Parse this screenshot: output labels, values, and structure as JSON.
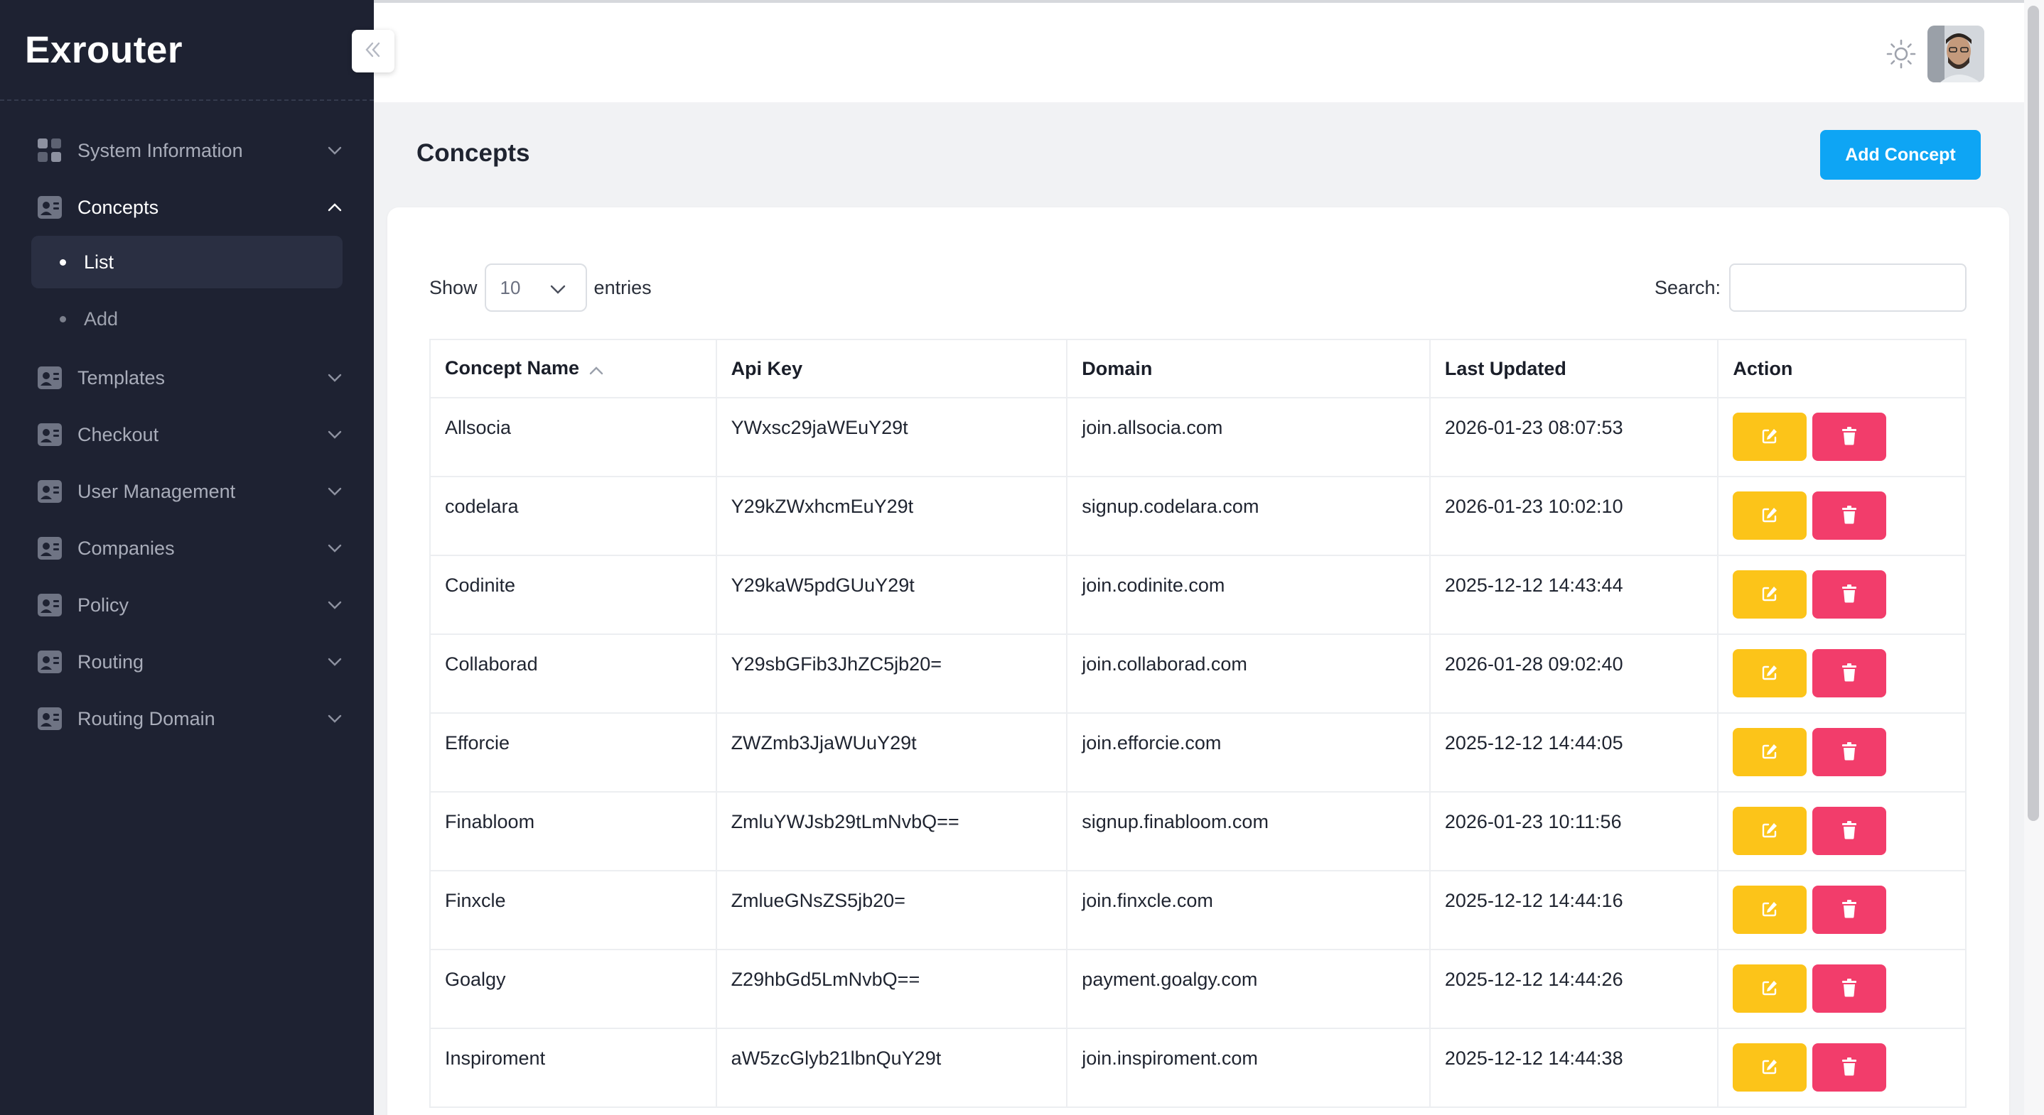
{
  "app": {
    "brand": "Exrouter"
  },
  "sidebar": {
    "items": [
      {
        "label": "System Information",
        "icon": "grid-icon"
      },
      {
        "label": "Concepts",
        "icon": "id-card-icon",
        "expanded": true,
        "sub": [
          {
            "label": "List",
            "active": true
          },
          {
            "label": "Add"
          }
        ]
      },
      {
        "label": "Templates",
        "icon": "id-card-icon"
      },
      {
        "label": "Checkout",
        "icon": "id-card-icon"
      },
      {
        "label": "User Management",
        "icon": "id-card-icon"
      },
      {
        "label": "Companies",
        "icon": "id-card-icon"
      },
      {
        "label": "Policy",
        "icon": "id-card-icon"
      },
      {
        "label": "Routing",
        "icon": "id-card-icon"
      },
      {
        "label": "Routing Domain",
        "icon": "id-card-icon"
      }
    ]
  },
  "header": {
    "theme_icon": "sun-icon",
    "avatar": "user-avatar"
  },
  "page": {
    "title": "Concepts",
    "add_button": "Add Concept"
  },
  "controls": {
    "show_label": "Show",
    "page_size": "10",
    "entries_label": "entries",
    "search_label": "Search:",
    "search_value": ""
  },
  "table": {
    "columns": [
      "Concept Name",
      "Api Key",
      "Domain",
      "Last Updated",
      "Action"
    ],
    "rows": [
      [
        "Allsocia",
        "YWxsc29jaWEuY29t",
        "join.allsocia.com",
        "2026-01-23 08:07:53"
      ],
      [
        "codelara",
        "Y29kZWxhcmEuY29t",
        "signup.codelara.com",
        "2026-01-23 10:02:10"
      ],
      [
        "Codinite",
        "Y29kaW5pdGUuY29t",
        "join.codinite.com",
        "2025-12-12 14:43:44"
      ],
      [
        "Collaborad",
        "Y29sbGFib3JhZC5jb20=",
        "join.collaborad.com",
        "2026-01-28 09:02:40"
      ],
      [
        "Efforcie",
        "ZWZmb3JjaWUuY29t",
        "join.efforcie.com",
        "2025-12-12 14:44:05"
      ],
      [
        "Finabloom",
        "ZmluYWJsb29tLmNvbQ==",
        "signup.finabloom.com",
        "2026-01-23 10:11:56"
      ],
      [
        "Finxcle",
        "ZmlueGNsZS5jb20=",
        "join.finxcle.com",
        "2025-12-12 14:44:16"
      ],
      [
        "Goalgy",
        "Z29hbGd5LmNvbQ==",
        "payment.goalgy.com",
        "2025-12-12 14:44:26"
      ],
      [
        "Inspiroment",
        "aW5zcGlyb21lbnQuY29t",
        "join.inspiroment.com",
        "2025-12-12 14:44:38"
      ]
    ]
  },
  "colors": {
    "sidebar_bg": "#1e2232",
    "primary": "#0ea5f4",
    "edit": "#fcc419",
    "delete": "#f23d6b"
  }
}
